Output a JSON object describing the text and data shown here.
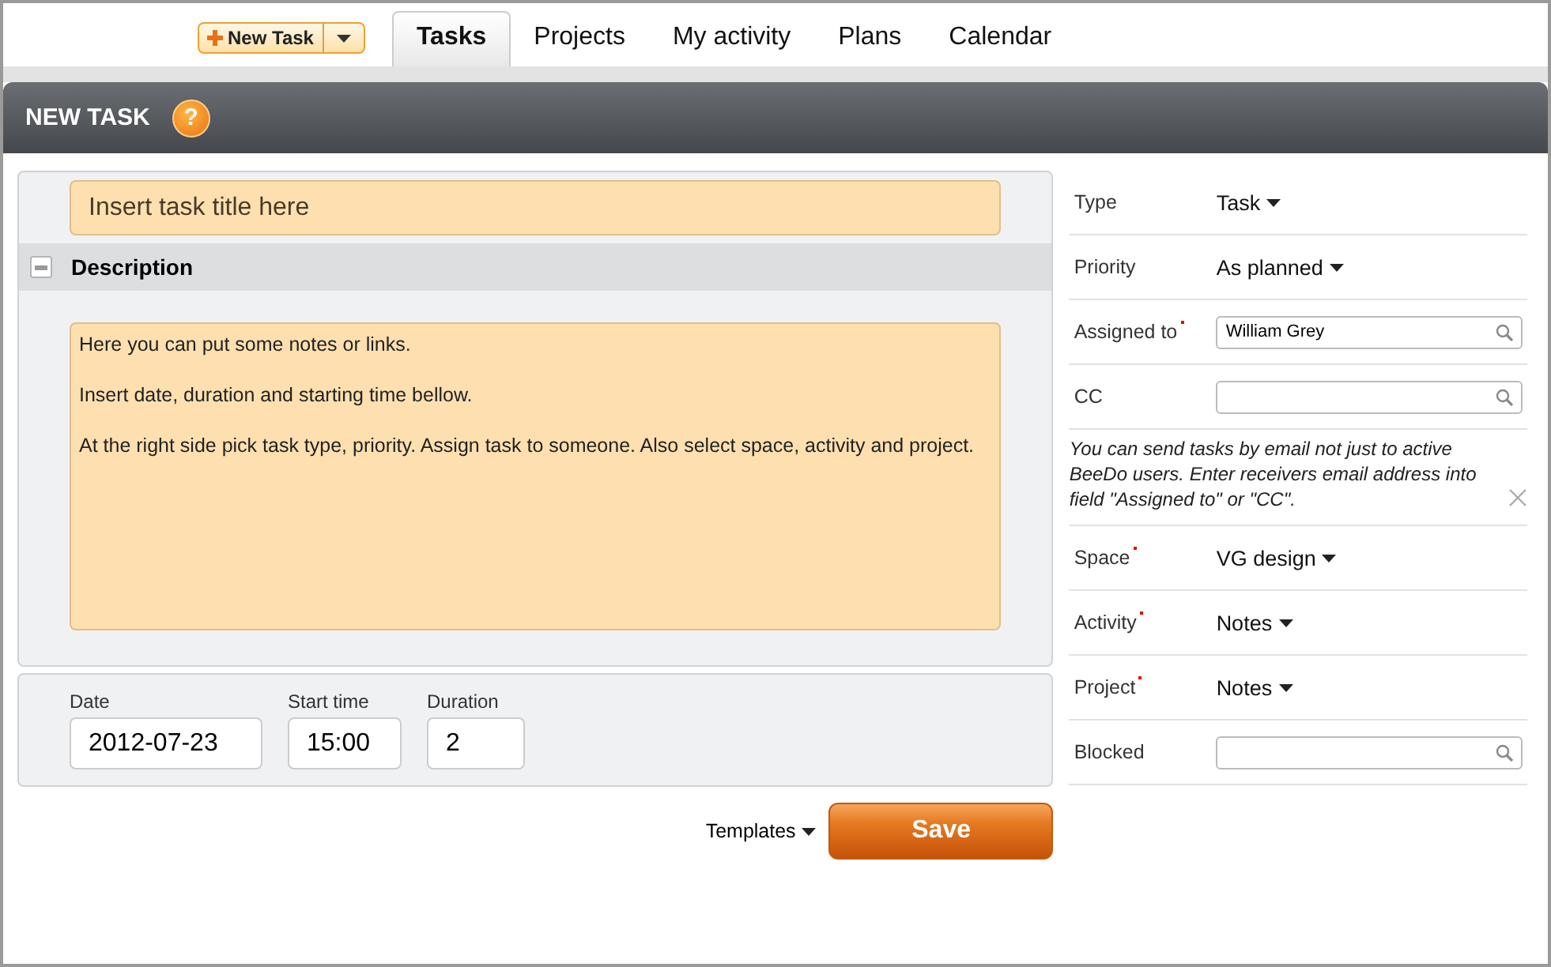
{
  "new_task_button": {
    "label": "New Task"
  },
  "tabs": [
    {
      "label": "Tasks",
      "selected": true
    },
    {
      "label": "Projects",
      "selected": false
    },
    {
      "label": "My activity",
      "selected": false
    },
    {
      "label": "Plans",
      "selected": false
    },
    {
      "label": "Calendar",
      "selected": false
    }
  ],
  "header": {
    "title": "NEW TASK",
    "help_label": "?"
  },
  "title_field": {
    "placeholder": "Insert task title here"
  },
  "description": {
    "label": "Description",
    "expanded": true,
    "value": "Here you can put some notes or links.\n\nInsert date, duration and starting time bellow.\n\nAt the right side pick task type, priority. Assign task to someone. Also select space, activity and project."
  },
  "schedule": [
    {
      "label": "Date",
      "value": "2012-07-23"
    },
    {
      "label": "Start time",
      "value": "15:00"
    },
    {
      "label": "Duration",
      "value": "2"
    }
  ],
  "templates": {
    "label": "Templates"
  },
  "save_button": {
    "label": "Save"
  },
  "properties": [
    {
      "kind": "dropdown",
      "label": "Type",
      "required": false,
      "value": "Task"
    },
    {
      "kind": "dropdown",
      "label": "Priority",
      "required": false,
      "value": "As planned"
    },
    {
      "kind": "search",
      "label": "Assigned to",
      "required": true,
      "value": "William Grey"
    },
    {
      "kind": "search",
      "label": "CC",
      "required": false
    },
    {
      "kind": "note",
      "text": "You can send tasks by email not just to active BeeDo users. Enter receivers email address into field \"Assigned to\" or \"CC\"."
    },
    {
      "kind": "dropdown",
      "label": "Space",
      "required": true,
      "value": "VG design"
    },
    {
      "kind": "dropdown",
      "label": "Activity",
      "required": true,
      "value": "Notes"
    },
    {
      "kind": "dropdown",
      "label": "Project",
      "required": true,
      "value": "Notes"
    },
    {
      "kind": "search",
      "label": "Blocked",
      "required": false
    }
  ]
}
